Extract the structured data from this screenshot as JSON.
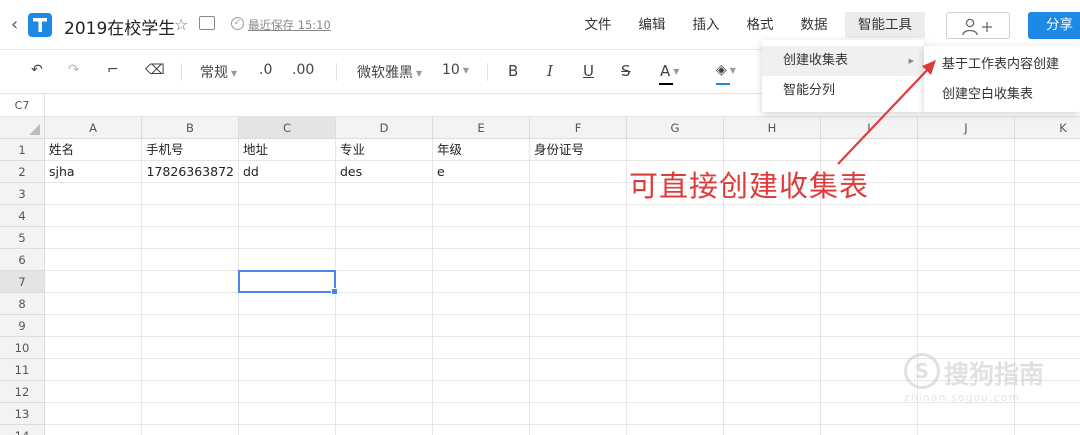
{
  "header": {
    "title": "2019在校学生",
    "save_status": "最近保存 15:10",
    "menus": [
      "文件",
      "编辑",
      "插入",
      "格式",
      "数据",
      "智能工具"
    ],
    "active_menu": "智能工具",
    "share_label": "分享",
    "add_user_icon": "person-plus-icon"
  },
  "toolbar": {
    "number_format": "常规",
    "decrease_decimal": ".0",
    "increase_decimal": ".00",
    "font_name": "微软雅黑",
    "font_size": "10",
    "bold": "B",
    "italic": "I",
    "underline": "U",
    "strike": "S",
    "font_color_letter": "A",
    "font_color": "#000000",
    "fill_color": "#1e88e5"
  },
  "formula_bar": {
    "cell_ref": "C7"
  },
  "grid": {
    "columns": [
      "A",
      "B",
      "C",
      "D",
      "E",
      "F",
      "G",
      "H",
      "I",
      "J",
      "K"
    ],
    "rows": [
      "1",
      "2",
      "3",
      "4",
      "5",
      "6",
      "7",
      "8",
      "9",
      "10",
      "11",
      "12",
      "13",
      "14"
    ],
    "selected_col": "C",
    "selected_row": "7",
    "row1": [
      "姓名",
      "手机号",
      "地址",
      "专业",
      "年级",
      "身份证号"
    ],
    "row2": [
      "sjha",
      "17826363872",
      "dd",
      "des",
      "e",
      ""
    ]
  },
  "dropdown": {
    "items": [
      "创建收集表",
      "智能分列"
    ],
    "submenu": [
      "基于工作表内容创建",
      "创建空白收集表"
    ]
  },
  "annotation": {
    "text": "可直接创建收集表",
    "color": "#e03b3b"
  },
  "watermark": {
    "glyph": "S",
    "text": "搜狗指南",
    "url": "zhinan.sogou.com"
  },
  "colors": {
    "accent": "#1e88e5",
    "selection": "#4a86e8"
  }
}
